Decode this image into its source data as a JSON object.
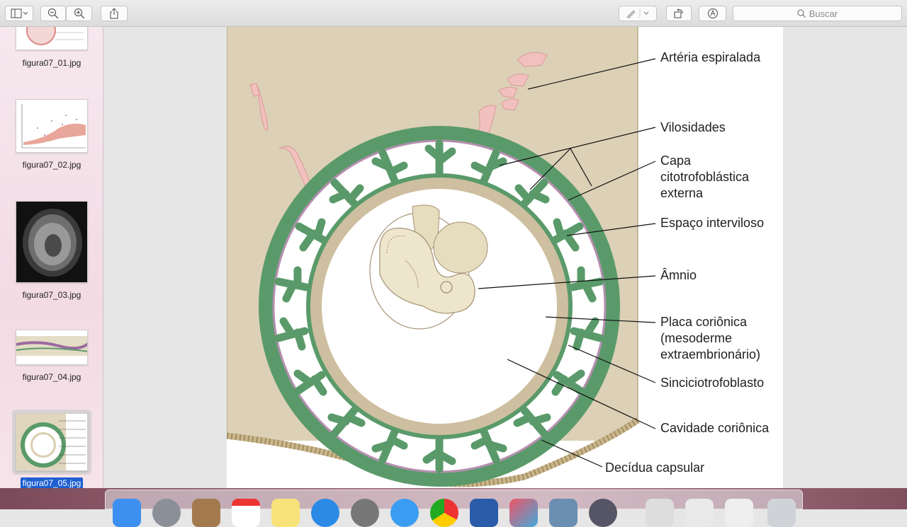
{
  "toolbar": {
    "window_title": "",
    "search_placeholder": "Buscar",
    "buttons": [
      "sidebar-toggle",
      "zoom-out",
      "zoom-in",
      "share",
      "markup",
      "rotate",
      "annotate"
    ]
  },
  "sidebar": {
    "items": [
      {
        "label": "figura07_01.jpg",
        "selected": false
      },
      {
        "label": "figura07_02.jpg",
        "selected": false
      },
      {
        "label": "figura07_03.jpg",
        "selected": false
      },
      {
        "label": "figura07_04.jpg",
        "selected": false
      },
      {
        "label": "figura07_05.jpg",
        "selected": true
      }
    ]
  },
  "figure": {
    "labels": {
      "arteria": "Artéria espiralada",
      "vilosidades": "Vilosidades",
      "capa": "Capa\ncitotrofoblástica\nexterna",
      "espaco": "Espaço interviloso",
      "amnio": "Âmnio",
      "placa": "Placa coriônica\n(mesoderme\nextraembrionário)",
      "sincicio": "Sinciciotrofoblasto",
      "cavidade": "Cavidade coriônica",
      "decidua": "Decídua capsular"
    }
  },
  "colors": {
    "decidua_bg": "#dcd0b6",
    "chorion_green": "#5a9a6a",
    "villi_purple": "#b58fb0",
    "artery_pink": "#f2c1bf",
    "selection_blue": "#1d5fd1"
  }
}
